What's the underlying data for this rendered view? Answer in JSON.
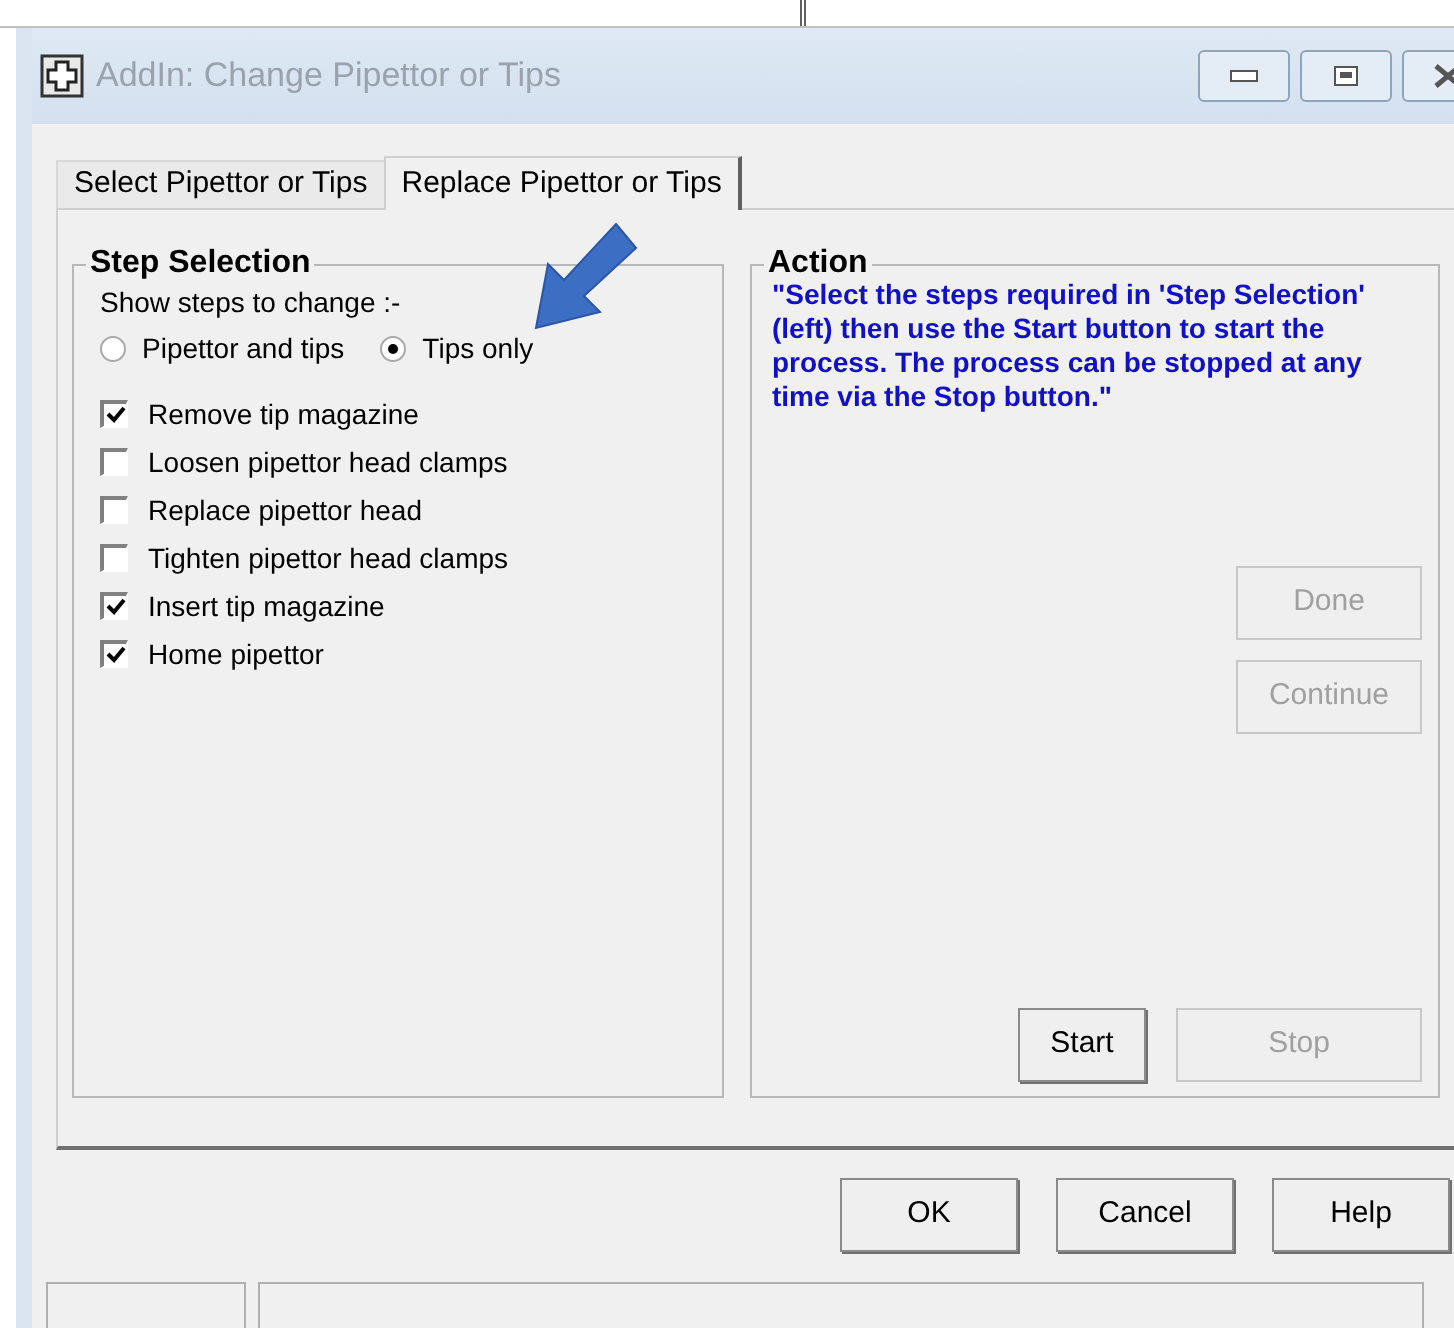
{
  "window": {
    "title": "AddIn: Change Pipettor or Tips"
  },
  "tabs": [
    {
      "label": "Select Pipettor or Tips",
      "selected": false
    },
    {
      "label": "Replace Pipettor or Tips",
      "selected": true
    }
  ],
  "step_selection": {
    "title": "Step Selection",
    "prompt": "Show steps to change :-",
    "radios": [
      {
        "label": "Pipettor and tips",
        "selected": false
      },
      {
        "label": "Tips only",
        "selected": true
      }
    ],
    "steps": [
      {
        "label": "Remove tip magazine",
        "checked": true
      },
      {
        "label": "Loosen pipettor head clamps",
        "checked": false
      },
      {
        "label": "Replace pipettor head",
        "checked": false
      },
      {
        "label": "Tighten pipettor head clamps",
        "checked": false
      },
      {
        "label": "Insert tip magazine",
        "checked": true
      },
      {
        "label": "Home pipettor",
        "checked": true
      }
    ]
  },
  "action": {
    "title": "Action",
    "message": "\"Select the steps required in 'Step Selection' (left) then use the Start button to start the process. The process can be stopped at any time via the Stop button.\"",
    "side_buttons": [
      {
        "label": "Done",
        "disabled": true
      },
      {
        "label": "Continue",
        "disabled": true
      }
    ],
    "bottom_buttons": [
      {
        "label": "Start",
        "disabled": false
      },
      {
        "label": "Stop",
        "disabled": true
      }
    ]
  },
  "dialog_buttons": [
    {
      "label": "OK",
      "disabled": false
    },
    {
      "label": "Cancel",
      "disabled": false
    },
    {
      "label": "Help",
      "disabled": false
    }
  ]
}
